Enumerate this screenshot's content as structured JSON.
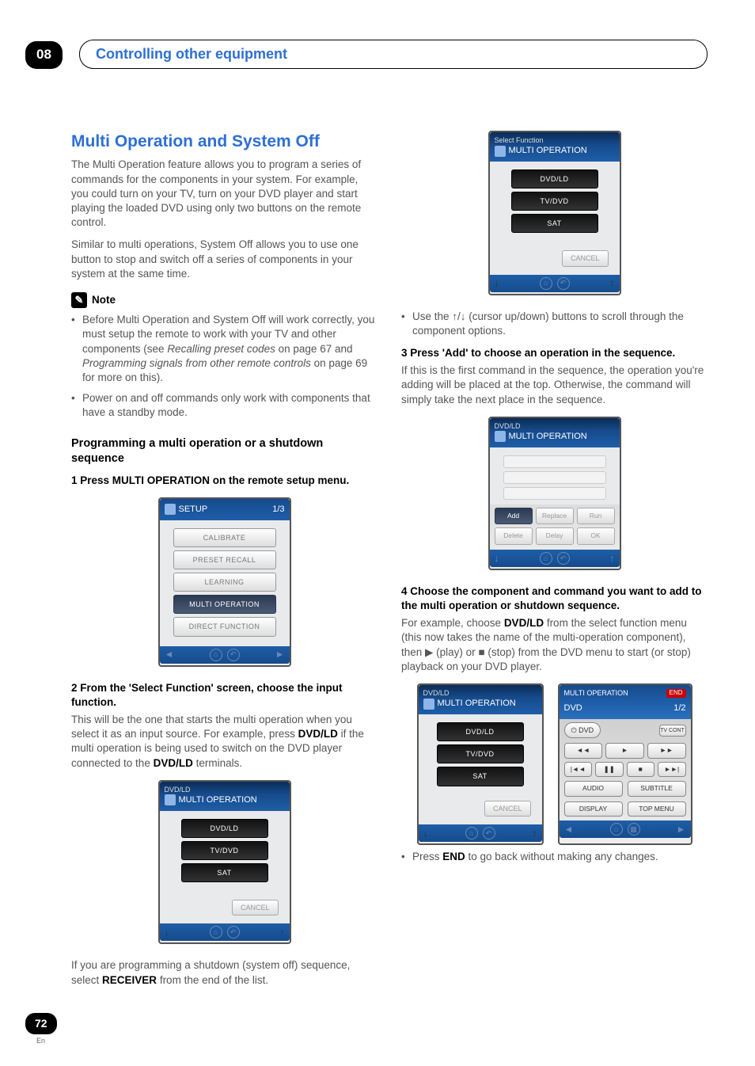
{
  "chapter_number": "08",
  "chapter_title": "Controlling other equipment",
  "page_number": "72",
  "page_lang": "En",
  "h1": "Multi Operation and System Off",
  "intro_p1": "The Multi Operation feature allows you to program a series of commands for the components in your system. For example, you could turn on your TV, turn on your DVD player and start playing the loaded DVD using only two buttons on the remote control.",
  "intro_p2": "Similar to multi operations, System Off allows you to use one button to stop and switch off a series of components in your system at the same time.",
  "note_label": "Note",
  "note_items": {
    "a_pre": "Before Multi Operation and System Off will work correctly, you must setup the remote to work with your TV and other components (see ",
    "a_em1": "Recalling preset codes",
    "a_mid": " on page 67 and ",
    "a_em2": "Programming signals from other remote controls",
    "a_post": " on page 69 for more on this).",
    "b": "Power on and off commands only work with components that have a standby mode."
  },
  "h2": "Programming a multi operation or a shutdown sequence",
  "steps": {
    "s1": "1   Press MULTI OPERATION on the remote setup menu.",
    "s2_heading": "2   From the 'Select Function' screen, choose the input function.",
    "s2_p_pre": "This will be the one that starts the multi operation when you select it as an input source. For example, press ",
    "s2_p_b1": "DVD/LD",
    "s2_p_mid": " if the multi operation is being used to switch on the DVD player connected to the ",
    "s2_p_b2": "DVD/LD",
    "s2_p_post": " terminals.",
    "col2_p_pre": "If you are programming a shutdown (system off) sequence, select ",
    "col2_p_b": "RECEIVER",
    "col2_p_post": " from the end of the list.",
    "cursor_tip": "Use the ↑/↓ (cursor up/down) buttons to scroll through the component options.",
    "s3_heading": "3   Press 'Add' to choose an operation in the sequence.",
    "s3_p": "If this is the first command in the sequence, the operation you're adding will be placed at the top. Otherwise, the command will simply take the next place in the sequence.",
    "s4_heading": "4   Choose the component and command you want to add to the multi operation or shutdown sequence.",
    "s4_p_pre": "For example, choose ",
    "s4_p_b1": "DVD/LD",
    "s4_p_mid1": " from the select function menu (this now takes the name of the multi-operation component), then ▶ (play) or ■ (stop) from the DVD menu to start (or stop) playback on your DVD player.",
    "end_tip_pre": "Press ",
    "end_tip_b": "END",
    "end_tip_post": " to go back without making any changes."
  },
  "screen_setup": {
    "title": "SETUP",
    "counter": "1/3",
    "items": [
      "CALIBRATE",
      "PRESET RECALL",
      "LEARNING",
      "MULTI OPERATION",
      "DIRECT FUNCTION"
    ]
  },
  "screen_selectA": {
    "subtitle": "DVD/LD",
    "title": "MULTI OPERATION",
    "items": [
      "DVD/LD",
      "TV/DVD",
      "SAT"
    ],
    "cancel": "CANCEL"
  },
  "screen_selectB": {
    "subtitle": "Select Function",
    "title": "MULTI OPERATION",
    "items": [
      "DVD/LD",
      "TV/DVD",
      "SAT"
    ],
    "cancel": "CANCEL"
  },
  "screen_addgrid": {
    "subtitle": "DVD/LD",
    "title": "MULTI OPERATION",
    "buttons": [
      "Add",
      "Replace",
      "Run",
      "Delete",
      "Delay",
      "OK"
    ]
  },
  "screen_dvd": {
    "header_small": "MULTI OPERATION",
    "end": "END",
    "line2_left": "DVD",
    "line2_right": "1/2",
    "power": "⏻ DVD",
    "tvcont": "TV CONT",
    "audio": "AUDIO",
    "subtitle": "SUBTITLE",
    "display": "DISPLAY",
    "topmenu": "TOP MENU"
  }
}
